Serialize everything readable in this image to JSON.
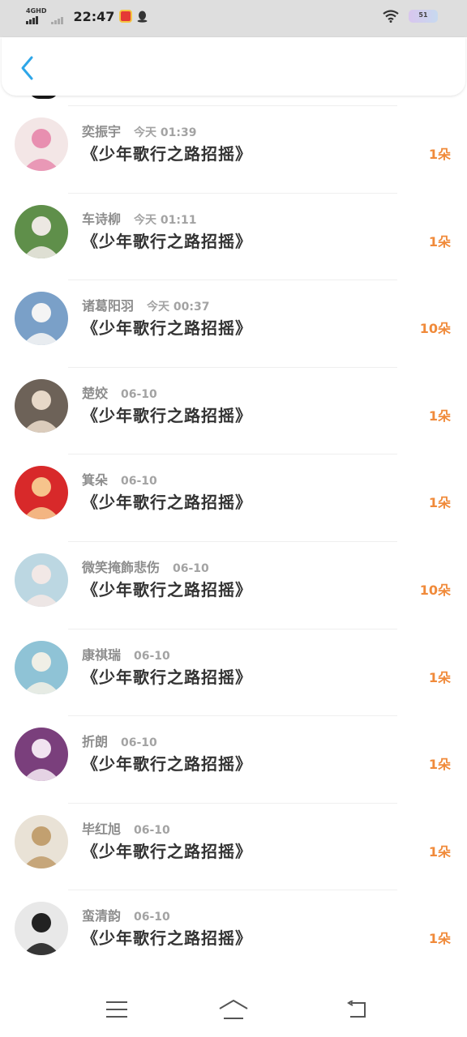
{
  "status_bar": {
    "network": "4GHD",
    "time": "22:47",
    "battery": "51"
  },
  "list": {
    "items": [
      {
        "name": "奕振宇",
        "time": "今天 01:39",
        "title": "《少年歌行之路招摇》",
        "count": "1朵",
        "avatar": {
          "bg": "#f3e6e6",
          "fg": "#e88fb0"
        }
      },
      {
        "name": "车诗柳",
        "time": "今天 01:11",
        "title": "《少年歌行之路招摇》",
        "count": "1朵",
        "avatar": {
          "bg": "#5f8f4a",
          "fg": "#ece8e2"
        }
      },
      {
        "name": "诸葛阳羽",
        "time": "今天 00:37",
        "title": "《少年歌行之路招摇》",
        "count": "10朵",
        "avatar": {
          "bg": "#7aa0c8",
          "fg": "#f4f4f4"
        }
      },
      {
        "name": "楚姣",
        "time": "06-10",
        "title": "《少年歌行之路招摇》",
        "count": "1朵",
        "avatar": {
          "bg": "#6d6258",
          "fg": "#e7d8c8"
        }
      },
      {
        "name": "箕朵",
        "time": "06-10",
        "title": "《少年歌行之路招摇》",
        "count": "1朵",
        "avatar": {
          "bg": "#d8292a",
          "fg": "#f6c48c"
        }
      },
      {
        "name": "微笑掩飾悲伤",
        "time": "06-10",
        "title": "《少年歌行之路招摇》",
        "count": "10朵",
        "avatar": {
          "bg": "#bcd7e2",
          "fg": "#f2e8e6"
        }
      },
      {
        "name": "康祺瑞",
        "time": "06-10",
        "title": "《少年歌行之路招摇》",
        "count": "1朵",
        "avatar": {
          "bg": "#8fc3d6",
          "fg": "#f0efe6"
        }
      },
      {
        "name": "折朗",
        "time": "06-10",
        "title": "《少年歌行之路招摇》",
        "count": "1朵",
        "avatar": {
          "bg": "#7a3f7c",
          "fg": "#f1e3f0"
        }
      },
      {
        "name": "毕红旭",
        "time": "06-10",
        "title": "《少年歌行之路招摇》",
        "count": "1朵",
        "avatar": {
          "bg": "#e9e2d6",
          "fg": "#c2a070"
        }
      },
      {
        "name": "蛮清韵",
        "time": "06-10",
        "title": "《少年歌行之路招摇》",
        "count": "1朵",
        "avatar": {
          "bg": "#e8e8e8",
          "fg": "#222222"
        }
      }
    ]
  },
  "icons": {
    "back": "chevron-left-icon",
    "nav_menu": "menu-icon",
    "nav_home": "home-icon",
    "nav_back": "return-icon"
  },
  "colors": {
    "accent": "#2ea6e8",
    "count": "#f08a3a",
    "name": "#8d8d8d",
    "title": "#333333"
  }
}
